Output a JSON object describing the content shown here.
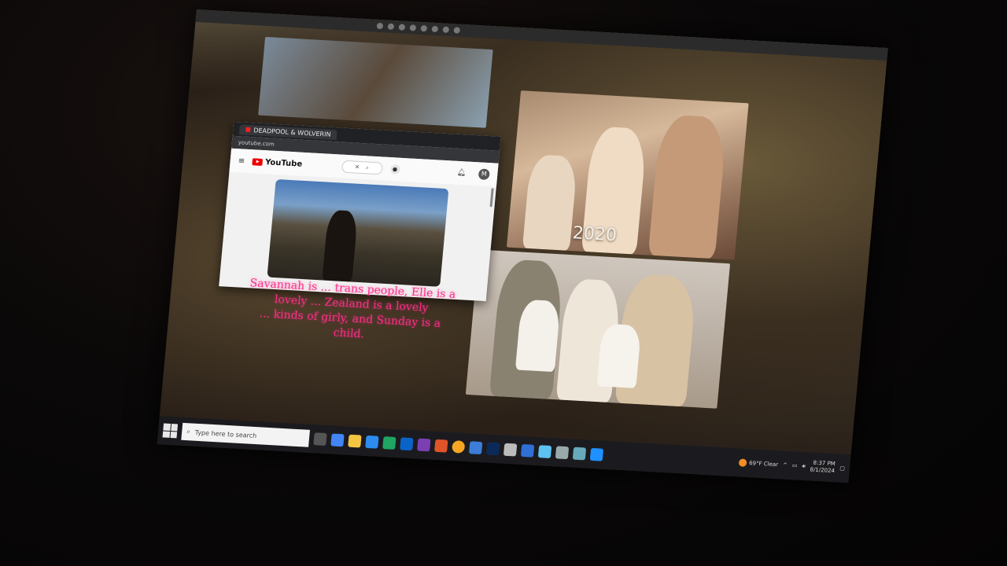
{
  "browser_tab": {
    "title": "DEADPOOL & WOLVERIN"
  },
  "address_bar": {
    "url": "youtube.com"
  },
  "youtube": {
    "logo_text": "YouTube",
    "avatar_initial": "M"
  },
  "photo_caption": "2020",
  "overlay_text": [
    "Savannah is ... trans people, Elle is a",
    "lovely ... Zealand is a lovely",
    "... kinds of girly, and Sunday is a",
    "child."
  ],
  "taskbar": {
    "search_placeholder": "Type here to search",
    "weather": "69°F Clear",
    "time": "8:37 PM",
    "date": "8/1/2024"
  },
  "colors": {
    "overlay_text": "#ff2d8a",
    "taskbar": "#1b1b1f",
    "youtube_red": "#e00000"
  }
}
